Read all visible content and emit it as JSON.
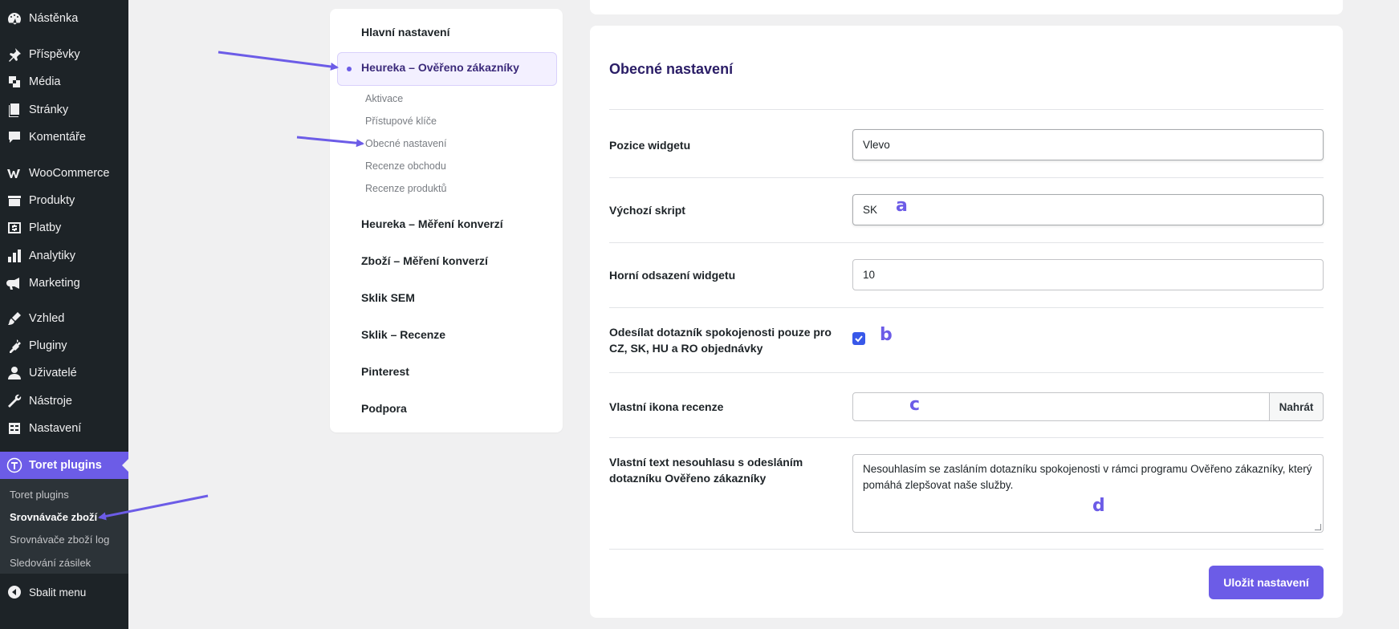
{
  "sidebar": {
    "items": [
      {
        "icon": "dashboard-icon",
        "label": "Nástěnka"
      },
      {
        "icon": "pin-icon",
        "label": "Příspěvky"
      },
      {
        "icon": "media-icon",
        "label": "Média"
      },
      {
        "icon": "pages-icon",
        "label": "Stránky"
      },
      {
        "icon": "comments-icon",
        "label": "Komentáře"
      },
      {
        "icon": "woocommerce-icon",
        "label": "WooCommerce"
      },
      {
        "icon": "products-icon",
        "label": "Produkty"
      },
      {
        "icon": "payments-icon",
        "label": "Platby"
      },
      {
        "icon": "analytics-icon",
        "label": "Analytiky"
      },
      {
        "icon": "megaphone-icon",
        "label": "Marketing"
      },
      {
        "icon": "brush-icon",
        "label": "Vzhled"
      },
      {
        "icon": "plugin-icon",
        "label": "Pluginy"
      },
      {
        "icon": "user-icon",
        "label": "Uživatelé"
      },
      {
        "icon": "wrench-icon",
        "label": "Nástroje"
      },
      {
        "icon": "settings-icon",
        "label": "Nastavení"
      },
      {
        "icon": "toret-icon",
        "label": "Toret plugins"
      }
    ],
    "submenu": [
      "Toret plugins",
      "Srovnávače zboží",
      "Srovnávače zboží log",
      "Sledování zásilek"
    ],
    "collapse_label": "Sbalit menu"
  },
  "settings_nav": {
    "general": "Hlavní nastavení",
    "active_section": "Heureka – Ověřeno zákazníky",
    "subitems": [
      "Aktivace",
      "Přístupové klíče",
      "Obecné nastavení",
      "Recenze obchodu",
      "Recenze produktů"
    ],
    "sections": [
      "Heureka – Měření konverzí",
      "Zboží – Měření konverzí",
      "Sklik SEM",
      "Sklik – Recenze",
      "Pinterest",
      "Podpora"
    ]
  },
  "form": {
    "title": "Obecné nastavení",
    "widget_position": {
      "label": "Pozice widgetu",
      "value": "Vlevo"
    },
    "default_script": {
      "label": "Výchozí skript",
      "value": "SK"
    },
    "top_offset": {
      "label": "Horní odsazení widgetu",
      "value": "10"
    },
    "send_only": {
      "label_line1": "Odesílat dotazník spokojenosti pouze pro",
      "label_line2": "CZ, SK, HU a RO objednávky",
      "checked": true
    },
    "custom_icon": {
      "label": "Vlastní ikona recenze",
      "upload_label": "Nahrát"
    },
    "disagree_text": {
      "label_line1": "Vlastní text nesouhlasu s odesláním",
      "label_line2": "dotazníku Ověřeno zákazníky",
      "value": "Nesouhlasím se zasláním dotazníku spokojenosti v rámci programu Ověřeno zákazníky, který pomáhá zlepšovat naše služby."
    },
    "save_label": "Uložit nastavení"
  },
  "annotations": {
    "a": "a",
    "b": "b",
    "c": "c",
    "d": "d"
  },
  "colors": {
    "accent": "#6c5ce7",
    "sidebar_bg": "#1d2327",
    "checkbox": "#3858e9"
  }
}
